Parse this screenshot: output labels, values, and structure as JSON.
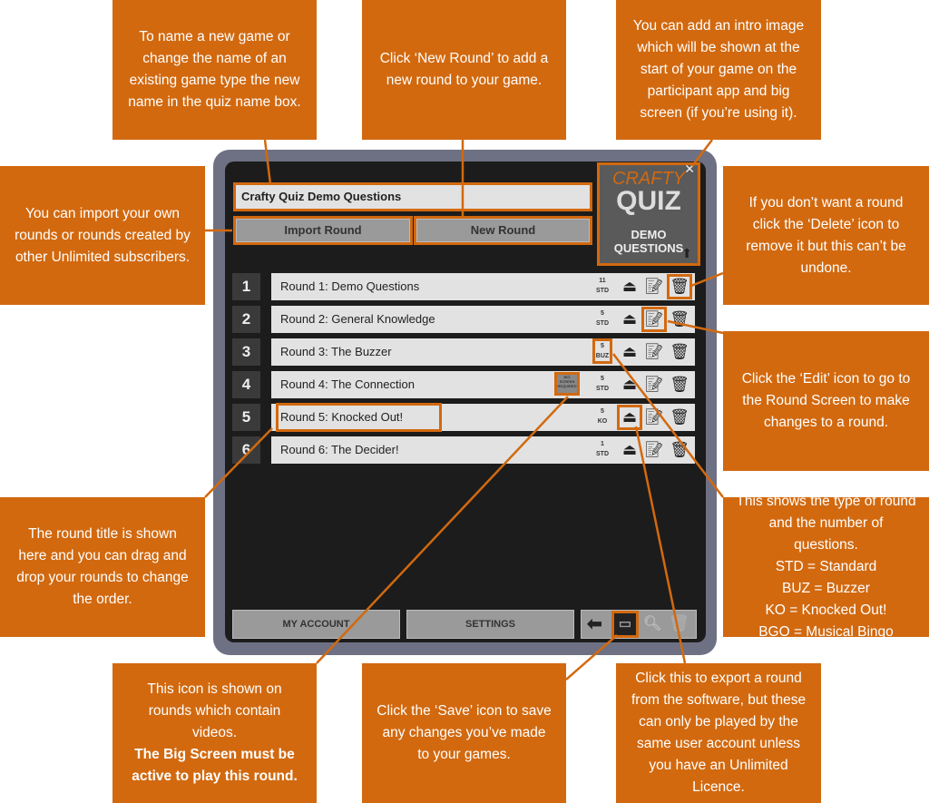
{
  "app": {
    "quiz_name": "Crafty Quiz Demo Questions",
    "import_label": "Import Round",
    "new_label": "New Round",
    "logo": {
      "line1": "CRAFTY",
      "line2": "QUIZ",
      "line3": "DEMO QUESTIONS"
    },
    "rounds": [
      {
        "num": "1",
        "title": "Round 1: Demo Questions",
        "count": "11",
        "type": "STD"
      },
      {
        "num": "2",
        "title": "Round 2: General Knowledge",
        "count": "5",
        "type": "STD"
      },
      {
        "num": "3",
        "title": "Round 3: The Buzzer",
        "count": "5",
        "type": "BUZ"
      },
      {
        "num": "4",
        "title": "Round 4: The Connection",
        "count": "5",
        "type": "STD",
        "video_badge": "BIG SCREEN REQUIRED"
      },
      {
        "num": "5",
        "title": "Round 5: Knocked Out!",
        "count": "5",
        "type": "KO"
      },
      {
        "num": "6",
        "title": "Round 6: The Decider!",
        "count": "1",
        "type": "STD"
      }
    ],
    "footer": {
      "account": "MY ACCOUNT",
      "settings": "SETTINGS"
    }
  },
  "callouts": {
    "name": "To name a new game or change the name of an existing game type the new name in the quiz name box.",
    "new_round": "Click ‘New Round’ to add a new round to your game.",
    "intro": "You can add an intro image which will be shown at the start of your game on the participant app and big screen (if you’re using it).",
    "import": "You can import your own rounds or rounds created by other Unlimited subscribers.",
    "delete": "If you don’t want a round click the ‘Delete’ icon to remove it but this can’t be undone.",
    "edit": "Click the ‘Edit’ icon to go to the Round Screen to make changes to a round.",
    "title": "The round title is shown here and you can drag and drop your rounds to change the order.",
    "types": [
      "This shows the type of round and the number of questions.",
      "STD = Standard",
      "BUZ = Buzzer",
      "KO = Knocked Out!",
      "BGO = Musical Bingo"
    ],
    "video": "This icon is shown on rounds which contain videos.",
    "video_bold": "The Big Screen must be active to play this round.",
    "save": "Click the ‘Save’ icon to save any changes you’ve made to your games.",
    "export": "Click this to export a round from the software, but these can only be played by the same user account unless you have an Unlimited Licence."
  },
  "colors": {
    "accent": "#d2690f",
    "frame": "#6e7183",
    "panel": "#1c1c1c"
  }
}
